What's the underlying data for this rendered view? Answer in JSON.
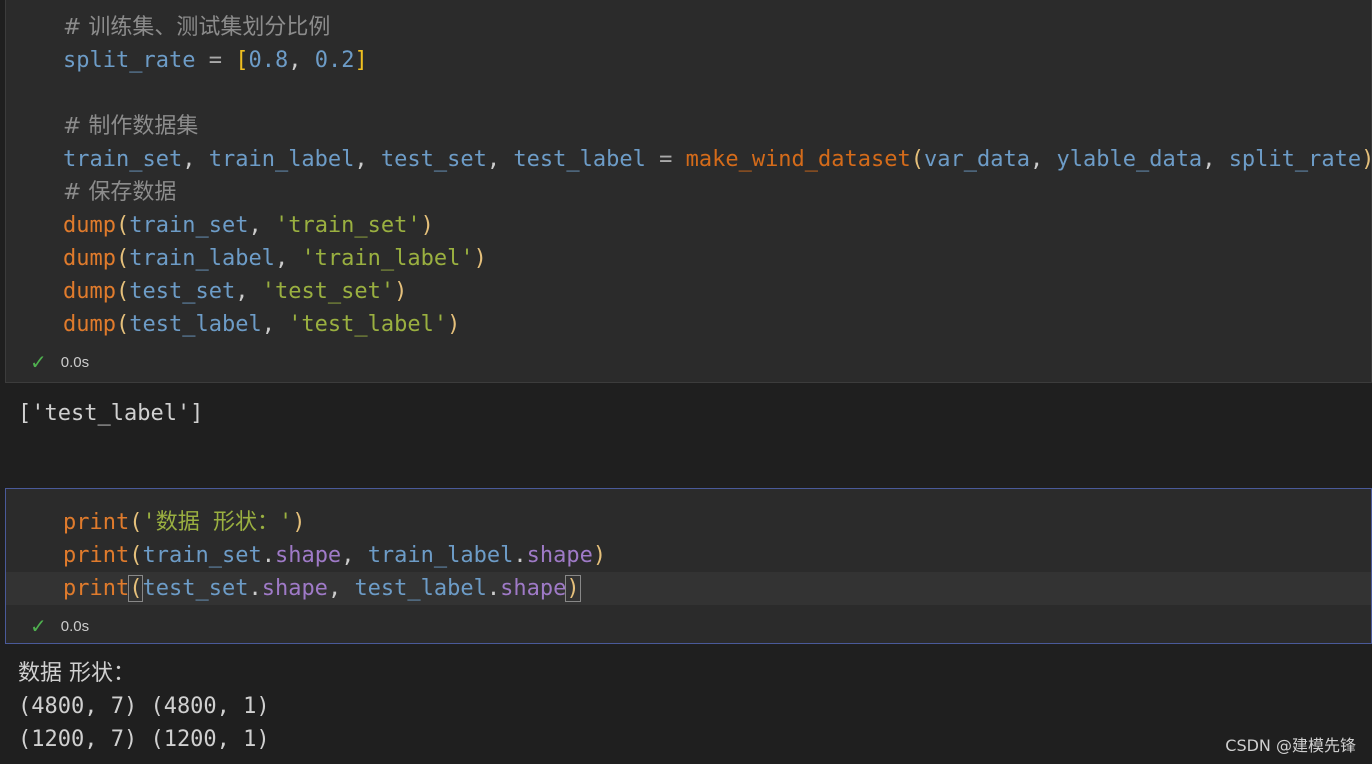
{
  "cell1": {
    "comment_split": "# 训练集、测试集划分比例",
    "split_var": "split_rate",
    "split_eq": " = ",
    "split_open": "[",
    "split_v1": "0.8",
    "split_comma": ", ",
    "split_v2": "0.2",
    "split_close": "]",
    "comment_make": "# 制作数据集",
    "make_lhs_1": "train_set",
    "make_lhs_2": "train_label",
    "make_lhs_3": "test_set",
    "make_lhs_4": "test_label",
    "make_func": "make_wind_dataset",
    "make_arg1": "var_data",
    "make_arg2": "ylable_data",
    "make_arg3": "split_rate",
    "comment_save": "# 保存数据",
    "dumps": [
      {
        "func": "dump",
        "arg": "train_set",
        "str": "'train_set'"
      },
      {
        "func": "dump",
        "arg": "train_label",
        "str": "'train_label'"
      },
      {
        "func": "dump",
        "arg": "test_set",
        "str": "'test_set'"
      },
      {
        "func": "dump",
        "arg": "test_label",
        "str": "'test_label'"
      }
    ],
    "status_time": "0.0s",
    "output": "['test_label']"
  },
  "cell2": {
    "print_func": "print",
    "print1_str": "'数据 形状：'",
    "print2_a": "train_set",
    "print2_b": "train_label",
    "print3_a": "test_set",
    "print3_b": "test_label",
    "attr": "shape",
    "status_time": "0.0s",
    "output_lines": [
      "数据 形状：",
      "(4800, 7) (4800, 1)",
      "(1200, 7) (1200, 1)"
    ]
  },
  "watermark": "CSDN @建模先锋"
}
